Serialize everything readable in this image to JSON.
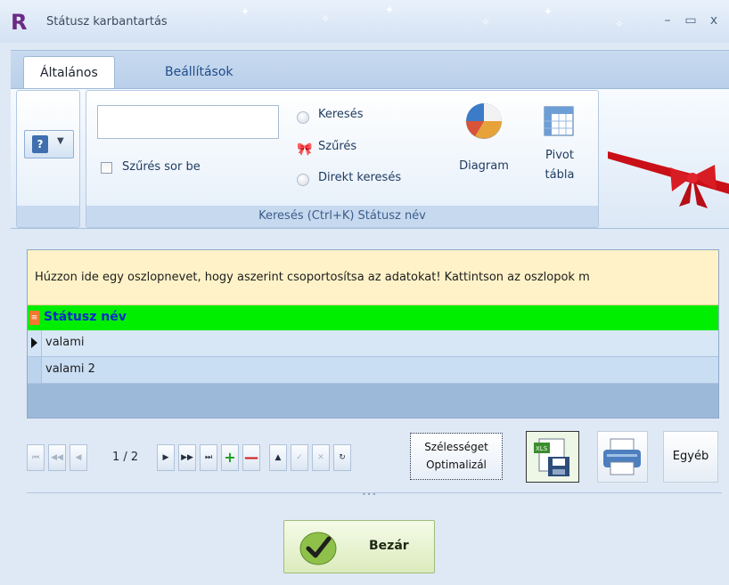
{
  "window": {
    "logo": "R",
    "title": "Státusz karbantartás",
    "minimize_glyph": "–",
    "maximize_glyph": "▭",
    "close_glyph": "x"
  },
  "tabs": [
    {
      "label": "Általános",
      "active": true
    },
    {
      "label": "Beállítások",
      "active": false
    }
  ],
  "ribbon": {
    "help_glyph": "?",
    "search_value": "",
    "filter_row_label": "Szűrés sor be",
    "filter_row_checked": false,
    "options": [
      {
        "label": "Keresés",
        "icon": "radio-icon"
      },
      {
        "label": "Szűrés",
        "icon": "ribbon-bow-icon"
      },
      {
        "label": "Direkt keresés",
        "icon": "radio-icon"
      }
    ],
    "diagram_label": "Diagram",
    "pivot_label_1": "Pivot",
    "pivot_label_2": "tábla",
    "group_caption": "Keresés (Ctrl+K) Státusz név"
  },
  "grid": {
    "group_hint": "Húzzon ide egy oszlopnevet, hogy aszerint csoportosítsa az adatokat! Kattintson az oszlopok m",
    "column_header": "Státusz név",
    "header_color": "#00ee00",
    "rows": [
      {
        "value": "valami",
        "current": true
      },
      {
        "value": "valami 2",
        "current": false
      }
    ]
  },
  "navigator": {
    "page": "1 / 2",
    "first": "⏮",
    "prev_page": "◀◀",
    "prev": "◀",
    "next": "▶",
    "next_page": "▶▶",
    "last": "⏭",
    "add": "+",
    "remove": "—",
    "up": "▲",
    "confirm": "✓",
    "cancel": "✕",
    "refresh": "↻",
    "optimize_label_1": "Szélességet",
    "optimize_label_2": "Optimalizál",
    "excel_badge": "XLS",
    "other_label": "Egyéb"
  },
  "footer": {
    "close_label": "Bezár"
  }
}
